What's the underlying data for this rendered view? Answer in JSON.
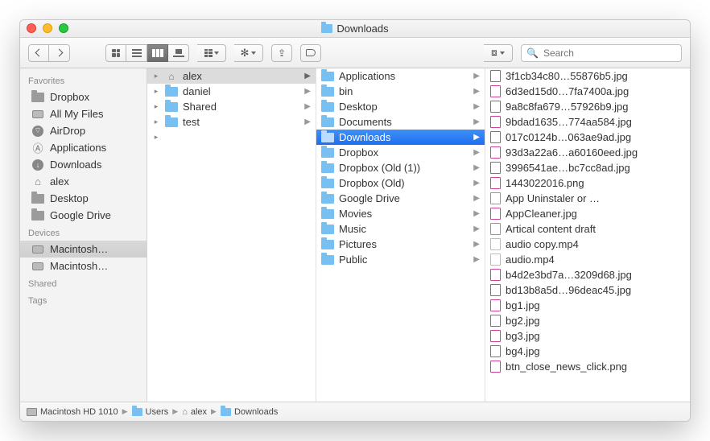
{
  "title": "Downloads",
  "search_placeholder": "Search",
  "sidebar": {
    "sections": [
      {
        "head": "Favorites",
        "items": [
          {
            "label": "Dropbox",
            "icon": "folder"
          },
          {
            "label": "All My Files",
            "icon": "allfiles"
          },
          {
            "label": "AirDrop",
            "icon": "airdrop"
          },
          {
            "label": "Applications",
            "icon": "apps"
          },
          {
            "label": "Downloads",
            "icon": "downloads"
          },
          {
            "label": "alex",
            "icon": "home"
          },
          {
            "label": "Desktop",
            "icon": "folder"
          },
          {
            "label": "Google Drive",
            "icon": "folder"
          }
        ]
      },
      {
        "head": "Devices",
        "items": [
          {
            "label": "Macintosh…",
            "icon": "disk",
            "selected": true
          },
          {
            "label": "Macintosh…",
            "icon": "disk"
          }
        ]
      },
      {
        "head": "Shared",
        "items": []
      },
      {
        "head": "Tags",
        "items": []
      }
    ]
  },
  "col1": [
    {
      "label": "alex",
      "icon": "home",
      "selected": true,
      "expandable": true
    },
    {
      "label": "daniel",
      "icon": "folder",
      "expandable": true
    },
    {
      "label": "Shared",
      "icon": "folder",
      "expandable": true
    },
    {
      "label": "test",
      "icon": "folder",
      "expandable": true
    }
  ],
  "col2": [
    {
      "label": "Applications"
    },
    {
      "label": "bin"
    },
    {
      "label": "Desktop"
    },
    {
      "label": "Documents"
    },
    {
      "label": "Downloads",
      "selected": true
    },
    {
      "label": "Dropbox"
    },
    {
      "label": "Dropbox (Old (1))"
    },
    {
      "label": "Dropbox (Old)"
    },
    {
      "label": "Google Drive"
    },
    {
      "label": "Movies"
    },
    {
      "label": "Music"
    },
    {
      "label": "Pictures"
    },
    {
      "label": "Public"
    }
  ],
  "col3": [
    {
      "label": "3f1cb34c80…55876b5.jpg",
      "type": "img"
    },
    {
      "label": "6d3ed15d0…7fa7400a.jpg",
      "type": "img"
    },
    {
      "label": "9a8c8fa679…57926b9.jpg",
      "type": "img"
    },
    {
      "label": "9bdad1635…774aa584.jpg",
      "type": "img"
    },
    {
      "label": "017c0124b…063ae9ad.jpg",
      "type": "img"
    },
    {
      "label": "93d3a22a6…a60160eed.jpg",
      "type": "img"
    },
    {
      "label": "3996541ae…bc7cc8ad.jpg",
      "type": "img"
    },
    {
      "label": "1443022016.png",
      "type": "img"
    },
    {
      "label": "App Uninstaler or …",
      "type": "doc"
    },
    {
      "label": "AppCleaner.jpg",
      "type": "img"
    },
    {
      "label": "Artical content draft",
      "type": "doc"
    },
    {
      "label": "audio copy.mp4",
      "type": "media"
    },
    {
      "label": "audio.mp4",
      "type": "media"
    },
    {
      "label": "b4d2e3bd7a…3209d68.jpg",
      "type": "img"
    },
    {
      "label": "bd13b8a5d…96deac45.jpg",
      "type": "img"
    },
    {
      "label": "bg1.jpg",
      "type": "img"
    },
    {
      "label": "bg2.jpg",
      "type": "img"
    },
    {
      "label": "bg3.jpg",
      "type": "img"
    },
    {
      "label": "bg4.jpg",
      "type": "img"
    },
    {
      "label": "btn_close_news_click.png",
      "type": "img"
    }
  ],
  "pathbar": [
    {
      "label": "Macintosh HD 1010",
      "icon": "disk"
    },
    {
      "label": "Users",
      "icon": "folder"
    },
    {
      "label": "alex",
      "icon": "home"
    },
    {
      "label": "Downloads",
      "icon": "folder"
    }
  ]
}
